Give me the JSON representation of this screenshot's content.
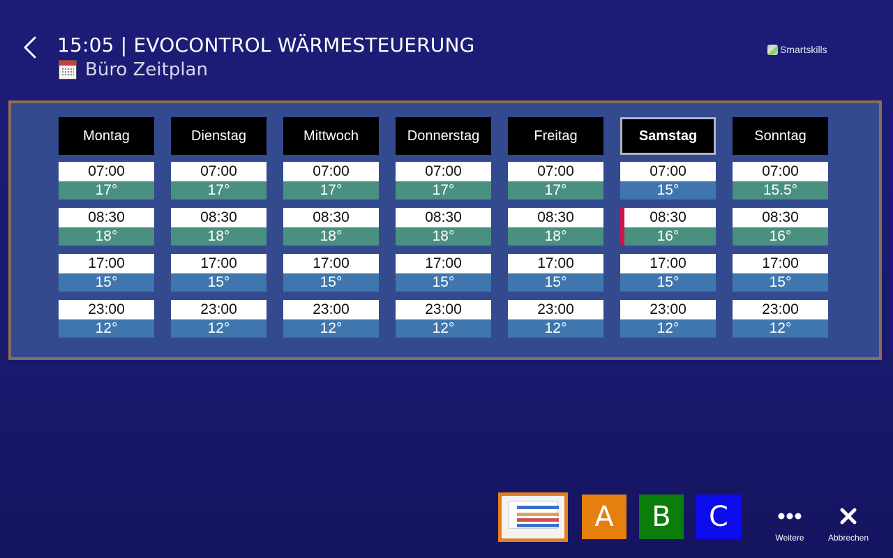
{
  "header": {
    "title": "15:05 | EVOCONTROL WÄRMESTEUERUNG",
    "subtitle": "Büro Zeitplan",
    "brand": "Smartskills"
  },
  "colors": {
    "warm": "#4a9080",
    "cool": "#3f76ad",
    "active_marker": "#d0124a",
    "panel_border": "#8a6c5b"
  },
  "schedule": [
    {
      "day": "Montag",
      "selected": false,
      "slots": [
        {
          "time": "07:00",
          "temp": "17°",
          "tone": "warm"
        },
        {
          "time": "08:30",
          "temp": "18°",
          "tone": "warm"
        },
        {
          "time": "17:00",
          "temp": "15°",
          "tone": "cool"
        },
        {
          "time": "23:00",
          "temp": "12°",
          "tone": "cool"
        }
      ]
    },
    {
      "day": "Dienstag",
      "selected": false,
      "slots": [
        {
          "time": "07:00",
          "temp": "17°",
          "tone": "warm"
        },
        {
          "time": "08:30",
          "temp": "18°",
          "tone": "warm"
        },
        {
          "time": "17:00",
          "temp": "15°",
          "tone": "cool"
        },
        {
          "time": "23:00",
          "temp": "12°",
          "tone": "cool"
        }
      ]
    },
    {
      "day": "Mittwoch",
      "selected": false,
      "slots": [
        {
          "time": "07:00",
          "temp": "17°",
          "tone": "warm"
        },
        {
          "time": "08:30",
          "temp": "18°",
          "tone": "warm"
        },
        {
          "time": "17:00",
          "temp": "15°",
          "tone": "cool"
        },
        {
          "time": "23:00",
          "temp": "12°",
          "tone": "cool"
        }
      ]
    },
    {
      "day": "Donnerstag",
      "selected": false,
      "slots": [
        {
          "time": "07:00",
          "temp": "17°",
          "tone": "warm"
        },
        {
          "time": "08:30",
          "temp": "18°",
          "tone": "warm"
        },
        {
          "time": "17:00",
          "temp": "15°",
          "tone": "cool"
        },
        {
          "time": "23:00",
          "temp": "12°",
          "tone": "cool"
        }
      ]
    },
    {
      "day": "Freitag",
      "selected": false,
      "slots": [
        {
          "time": "07:00",
          "temp": "17°",
          "tone": "warm"
        },
        {
          "time": "08:30",
          "temp": "18°",
          "tone": "warm"
        },
        {
          "time": "17:00",
          "temp": "15°",
          "tone": "cool"
        },
        {
          "time": "23:00",
          "temp": "12°",
          "tone": "cool"
        }
      ]
    },
    {
      "day": "Samstag",
      "selected": true,
      "slots": [
        {
          "time": "07:00",
          "temp": "15°",
          "tone": "cool"
        },
        {
          "time": "08:30",
          "temp": "16°",
          "tone": "warm",
          "active": true
        },
        {
          "time": "17:00",
          "temp": "15°",
          "tone": "cool"
        },
        {
          "time": "23:00",
          "temp": "12°",
          "tone": "cool"
        }
      ]
    },
    {
      "day": "Sonntag",
      "selected": false,
      "slots": [
        {
          "time": "07:00",
          "temp": "15.5°",
          "tone": "warm"
        },
        {
          "time": "08:30",
          "temp": "16°",
          "tone": "warm"
        },
        {
          "time": "17:00",
          "temp": "15°",
          "tone": "cool"
        },
        {
          "time": "23:00",
          "temp": "12°",
          "tone": "cool"
        }
      ]
    }
  ],
  "toolbar": {
    "device_icon": "thermostat-device-icon",
    "buttons": [
      {
        "label": "A",
        "color": "#e57f0e"
      },
      {
        "label": "B",
        "color": "#0a7d0a"
      },
      {
        "label": "C",
        "color": "#0c0cee"
      }
    ],
    "more_label": "Weitere",
    "cancel_label": "Abbrechen"
  }
}
